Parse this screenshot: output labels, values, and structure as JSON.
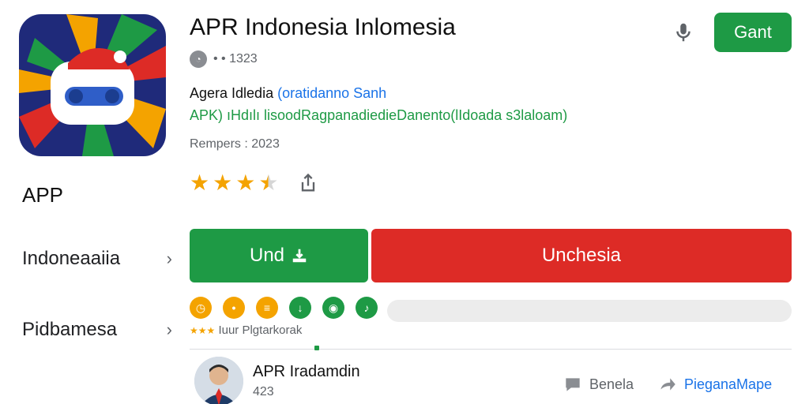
{
  "app": {
    "title": "APR Indonesia Inlomesia",
    "get_label": "Gant",
    "meta_text": "• • 1323",
    "developer": "Agera Idledia",
    "developer_link": "(oratidanno Sanh",
    "tagline": "APK) ıHdılı lisoodRagpanadiedieDanento(lIdoada s3laloam)",
    "release": "Rempers : 2023",
    "rating_value": 3.5,
    "rating_max": 4
  },
  "sidebar": {
    "label": "APP",
    "items": [
      {
        "label": "Indoneaaiia"
      },
      {
        "label": "Pidbamesa"
      }
    ]
  },
  "actions": {
    "install_label": "Und",
    "open_label": "Unchesia"
  },
  "chips": {
    "caption": "Iuur Plgtarkorak",
    "items": [
      {
        "icon": "clock-icon",
        "color": "#f4a300"
      },
      {
        "icon": "dots-icon",
        "color": "#f4a300"
      },
      {
        "icon": "document-icon",
        "color": "#f4a300"
      },
      {
        "icon": "download-icon",
        "color": "#1e9a45"
      },
      {
        "icon": "game-icon",
        "color": "#1e9a45"
      },
      {
        "icon": "music-icon",
        "color": "#1e9a45"
      }
    ]
  },
  "review": {
    "name": "APR Iradamdin",
    "count": "423",
    "react_label": "Benela",
    "share_label": "PieganaMape"
  },
  "colors": {
    "green": "#1e9a45",
    "red": "#dd2b26",
    "star": "#f4a300",
    "link": "#1a73e8"
  }
}
